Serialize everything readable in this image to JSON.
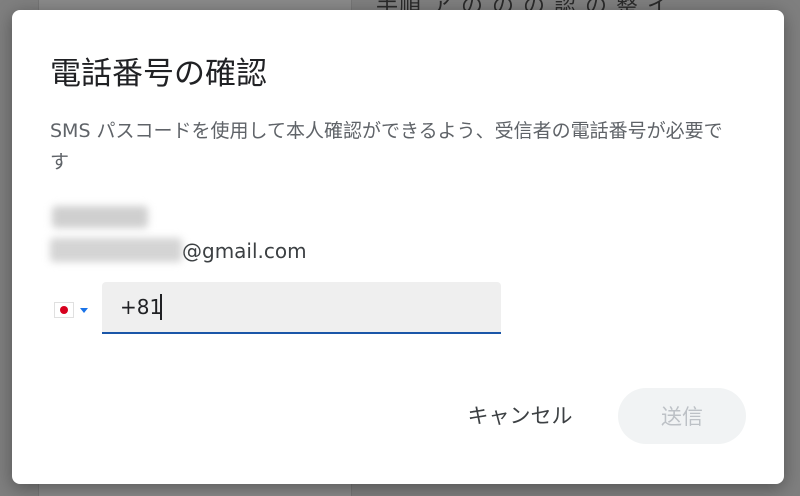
{
  "background": {
    "text": "手順 ア の の の 認 の 整 イ"
  },
  "dialog": {
    "title": "電話番号の確認",
    "description": "SMS パスコードを使用して本人確認ができるよう、受信者の電話番号が必要です",
    "recipient": {
      "email_domain": "@gmail.com"
    },
    "phone": {
      "country_flag_icon": "flag-japan-icon",
      "value": "+81"
    },
    "buttons": {
      "cancel": "キャンセル",
      "send": "送信"
    }
  },
  "colors": {
    "accent": "#1a56a8",
    "dropdown_caret": "#1a73e8",
    "disabled_text": "#bdc1c6",
    "disabled_bg": "#f1f3f4"
  }
}
